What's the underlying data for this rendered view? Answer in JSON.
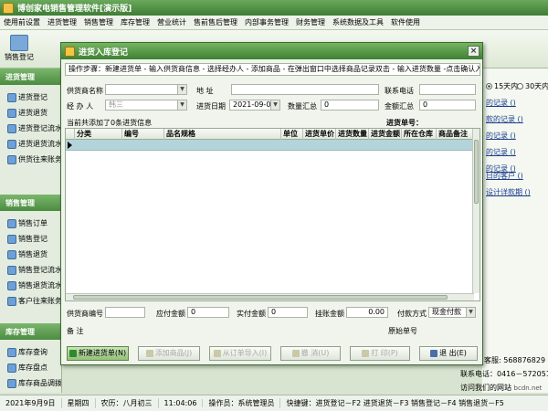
{
  "app": {
    "title": "博创家电销售管理软件[演示版]"
  },
  "menu": [
    "使用前设置",
    "进货管理",
    "销售管理",
    "库存管理",
    "营业统计",
    "售前售后管理",
    "内部事务管理",
    "财务管理",
    "系统数据及工具",
    "软件使用"
  ],
  "toolbar": {
    "items": [
      "销售登记"
    ]
  },
  "sidebar": {
    "sections": [
      {
        "title": "进货管理",
        "items": [
          "进货登记",
          "进货退货",
          "进货登记流水",
          "进货退货流水",
          "供货往来账务"
        ]
      },
      {
        "title": "销售管理",
        "items": [
          "销售订单",
          "销售登记",
          "销售退货",
          "销售登记流水",
          "销售退货流水",
          "客户往来账务"
        ]
      },
      {
        "title": "库存管理",
        "items": [
          "库存查询",
          "库存盘点",
          "库存商品调拨"
        ]
      }
    ]
  },
  "rightpanel": {
    "radio_15": "15天内",
    "radio_30": "30天内",
    "links": [
      "的记录 ()",
      "款的记录 ()",
      "的记录 ()",
      "的记录 ()",
      "的记录 ()",
      "日的客户 ()",
      "设计详款期 ()"
    ],
    "phone1": "客服: 568876829",
    "phone2": "联系电话：0416－5720518",
    "website_prefix": "访问我们的网站",
    "website": "bcdn.net"
  },
  "statusbar": {
    "date": "2021年9月9日",
    "weekday": "星期四",
    "lunar": "农历：八月初三",
    "time": "11:04:06",
    "operator": "操作员：系统管理员",
    "shortcuts": "快捷键：进货登记－F2 进货退货－F3 销售登记－F4 销售退货－F5"
  },
  "dialog": {
    "title": "进货入库登记",
    "close": "×",
    "steps": "操作步骤：新建进货单 - 输入供货商信息 - 选择经办人 - 添加商品 - 在弹出窗口中选择商品记录双击 - 输入进货数量 -点击确认入库按钮-",
    "supplier_label": "供货商名称",
    "address_label": "地    址",
    "phone_label": "联系电话",
    "handler_label": "经 办 人",
    "handler_value": "韩三",
    "date_label": "进货日期",
    "date_value": "2021-09-09",
    "qty_total_label": "数量汇总",
    "qty_total_value": "0",
    "amount_total_label": "金额汇总",
    "amount_total_value": "0",
    "added_info": "当前共添加了0条进货信息",
    "order_no_label": "进货单号：",
    "columns": [
      "分类",
      "编号",
      "品名规格",
      "单位",
      "进货单价",
      "进货数量",
      "进货金额",
      "所在仓库",
      "商品备注"
    ],
    "supplier_no_label": "供货商编号",
    "payable_label": "应付金额",
    "payable_value": "0",
    "paid_label": "实付金额",
    "paid_value": "0",
    "credit_label": "挂账金额",
    "credit_value": "0.00",
    "payment_label": "付款方式",
    "payment_value": "现金付款",
    "remark_label": "备    注",
    "original_no_label": "原始单号",
    "buttons": {
      "new": "新建进货单(N)",
      "add": "添加商品(J)",
      "import": "从订单导入(I)",
      "undo": "撤 消(U)",
      "print": "打 印(P)",
      "exit": "退 出(E)"
    }
  },
  "colors": {
    "title_green": "#3e8032",
    "row_highlight": "#b4d4dc"
  }
}
